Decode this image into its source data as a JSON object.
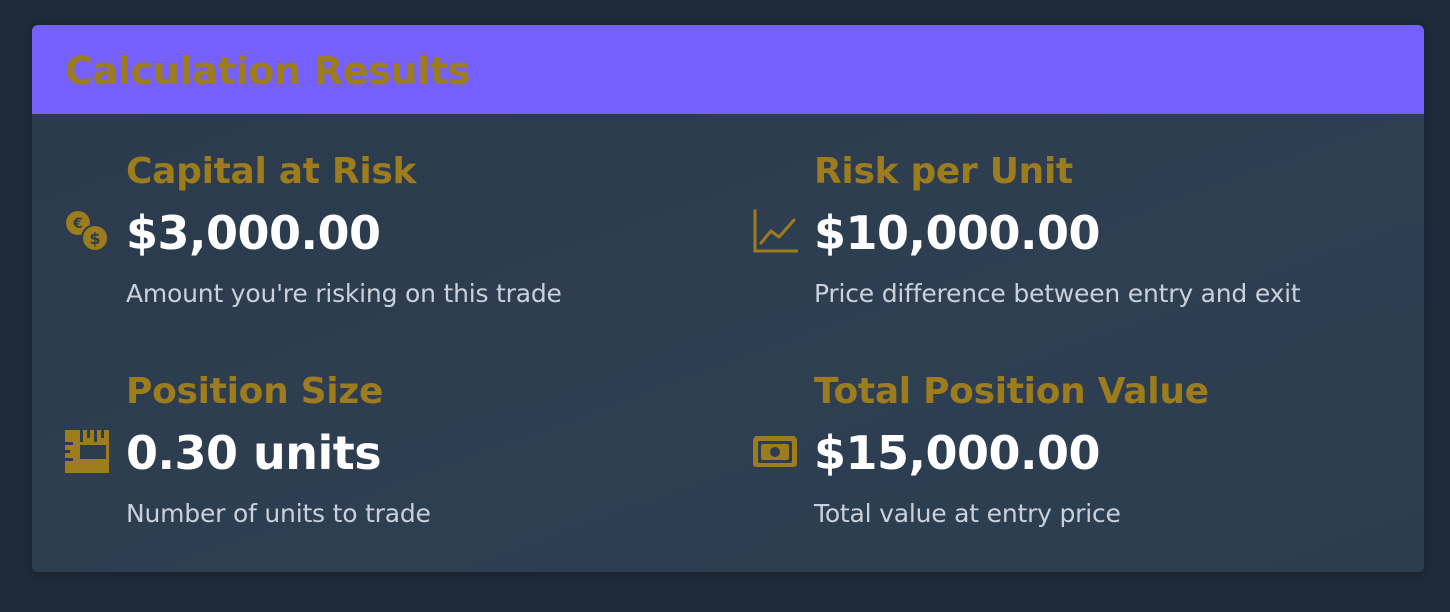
{
  "header": {
    "title": "Calculation Results"
  },
  "results": [
    {
      "label": "Capital at Risk",
      "value": "$3,000.00",
      "description": "Amount you're risking on this trade",
      "icon": "coins-euro-dollar-icon"
    },
    {
      "label": "Risk per Unit",
      "value": "$10,000.00",
      "description": "Price difference between entry and exit",
      "icon": "line-chart-icon"
    },
    {
      "label": "Position Size",
      "value": "0.30 units",
      "description": "Number of units to trade",
      "icon": "ruler-icon"
    },
    {
      "label": "Total Position Value",
      "value": "$15,000.00",
      "description": "Total value at entry price",
      "icon": "banknote-icon"
    }
  ],
  "colors": {
    "page_background": "#1e2b3b",
    "card_background": "#2d3d50",
    "header_background": "#7660fb",
    "accent_gold": "#9c7c1c",
    "value_text": "#ffffff",
    "description_text": "#c9d1dc"
  }
}
